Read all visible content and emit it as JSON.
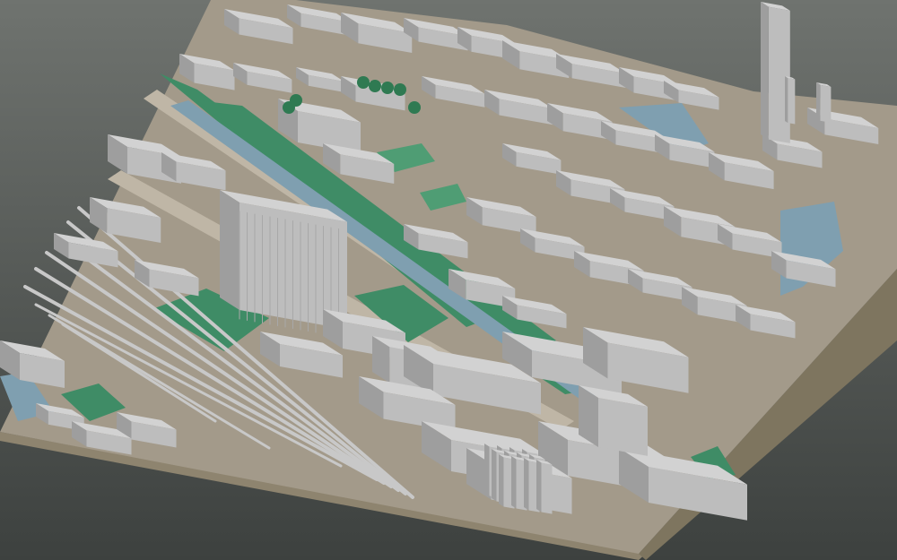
{
  "scene": {
    "type": "3d-city-block-model",
    "colors": {
      "background_top": "#6f736f",
      "background_bottom": "#3d413f",
      "base_top": "#a39a8a",
      "base_side": "#8e846f",
      "building_roof": "#d2d2d2",
      "building_left": "#bdbdbd",
      "building_right": "#9e9e9e",
      "park": "#3f8c66",
      "park_light": "#4f9d74",
      "water": "#7f9fb0",
      "rail": "#c8c8c8",
      "road": "#bfb6a6"
    },
    "features": [
      "river-channel",
      "green-parks",
      "rail-yard",
      "tall-tower",
      "large-office-block",
      "dense-building-blocks",
      "trees"
    ]
  }
}
